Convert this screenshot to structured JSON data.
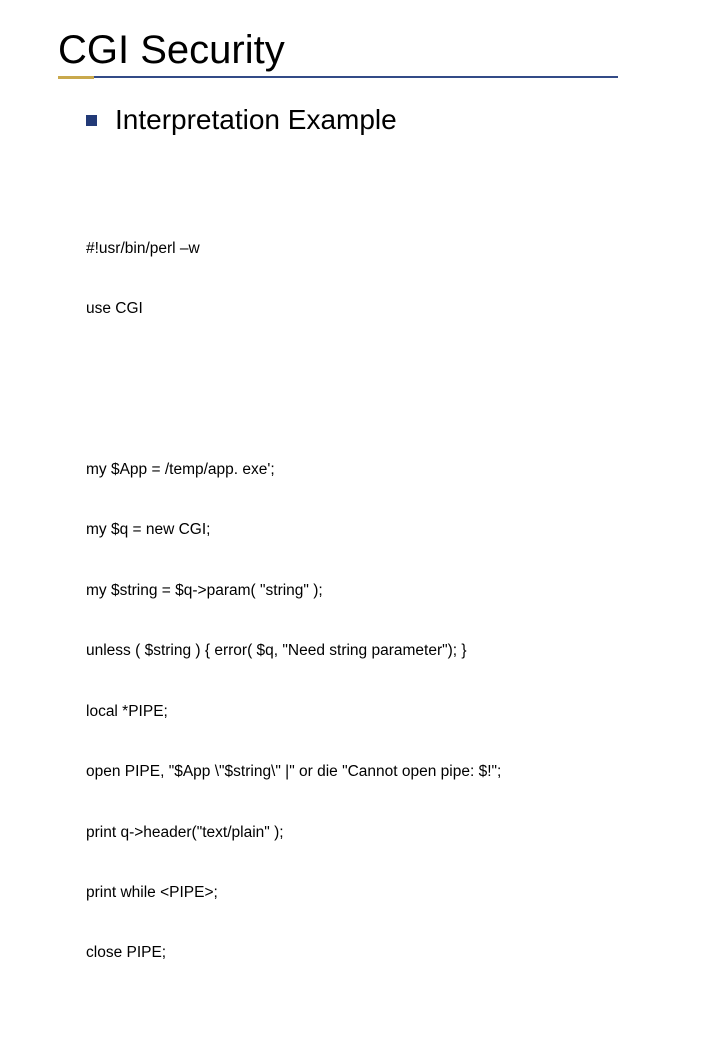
{
  "title": "CGI Security",
  "subtitle": "Interpretation Example",
  "code": {
    "p1_l1": "#!usr/bin/perl –w",
    "p1_l2": "use CGI",
    "p2_l1": "my $App = /temp/app. exe';",
    "p2_l2": "my $q = new CGI;",
    "p2_l3": "my $string = $q->param( \"string\" );",
    "p2_l4": "unless ( $string ) { error( $q, \"Need string parameter\"); }",
    "p2_l5": "local *PIPE;",
    "p2_l6": "open PIPE, \"$App \\\"$string\\\" |\" or die \"Cannot open pipe: $!\";",
    "p2_l7": "print q->header(\"text/plain\" );",
    "p2_l8": "print while <PIPE>;",
    "p2_l9": "close PIPE;"
  }
}
